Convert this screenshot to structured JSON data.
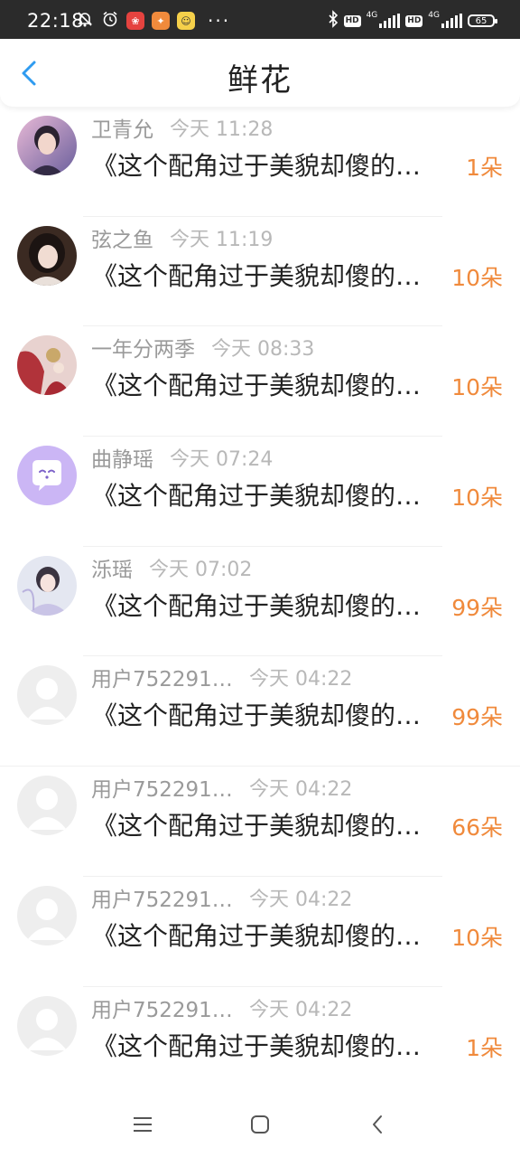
{
  "status_bar": {
    "time": "22:18",
    "icons": [
      "mute-bell-icon",
      "alarm-clock-icon",
      "app-icon-red",
      "app-icon-orange",
      "app-icon-yellow"
    ],
    "more": "···",
    "network_label_1": "4G",
    "network_label_2": "4G",
    "battery": "65"
  },
  "header": {
    "title": "鲜花"
  },
  "rows": [
    {
      "name": "卫青允",
      "time": "今天 11:28",
      "content": "《这个配角过于美貌却傻的…",
      "count": "1朵",
      "avatar": "photo-boy"
    },
    {
      "name": "弦之鱼",
      "time": "今天 11:19",
      "content": "《这个配角过于美貌却傻的…",
      "count": "10朵",
      "avatar": "photo-girl-dark"
    },
    {
      "name": "一年分两季",
      "time": "今天 08:33",
      "content": "《这个配角过于美貌却傻的…",
      "count": "10朵",
      "avatar": "photo-red"
    },
    {
      "name": "曲静瑶",
      "time": "今天 07:24",
      "content": "《这个配角过于美貌却傻的…",
      "count": "10朵",
      "avatar": "chat-bubble"
    },
    {
      "name": "泺瑶",
      "time": "今天 07:02",
      "content": "《这个配角过于美貌却傻的…",
      "count": "99朵",
      "avatar": "photo-girl-light"
    },
    {
      "name": "用户752291…",
      "time": "今天 04:22",
      "content": "《这个配角过于美貌却傻的…",
      "count": "99朵",
      "avatar": "default-user"
    },
    {
      "name": "用户752291…",
      "time": "今天 04:22",
      "content": "《这个配角过于美貌却傻的…",
      "count": "66朵",
      "avatar": "default-user"
    },
    {
      "name": "用户752291…",
      "time": "今天 04:22",
      "content": "《这个配角过于美貌却傻的…",
      "count": "10朵",
      "avatar": "default-user"
    },
    {
      "name": "用户752291…",
      "time": "今天 04:22",
      "content": "《这个配角过于美貌却傻的…",
      "count": "1朵",
      "avatar": "default-user"
    }
  ],
  "colors": {
    "accent_blue": "#2f9bf0",
    "count_orange": "#f08a3c",
    "status_bar_bg": "#2b2b2b"
  },
  "nav_bar": {
    "icons": [
      "menu-icon",
      "home-square-icon",
      "back-chevron-icon"
    ]
  }
}
